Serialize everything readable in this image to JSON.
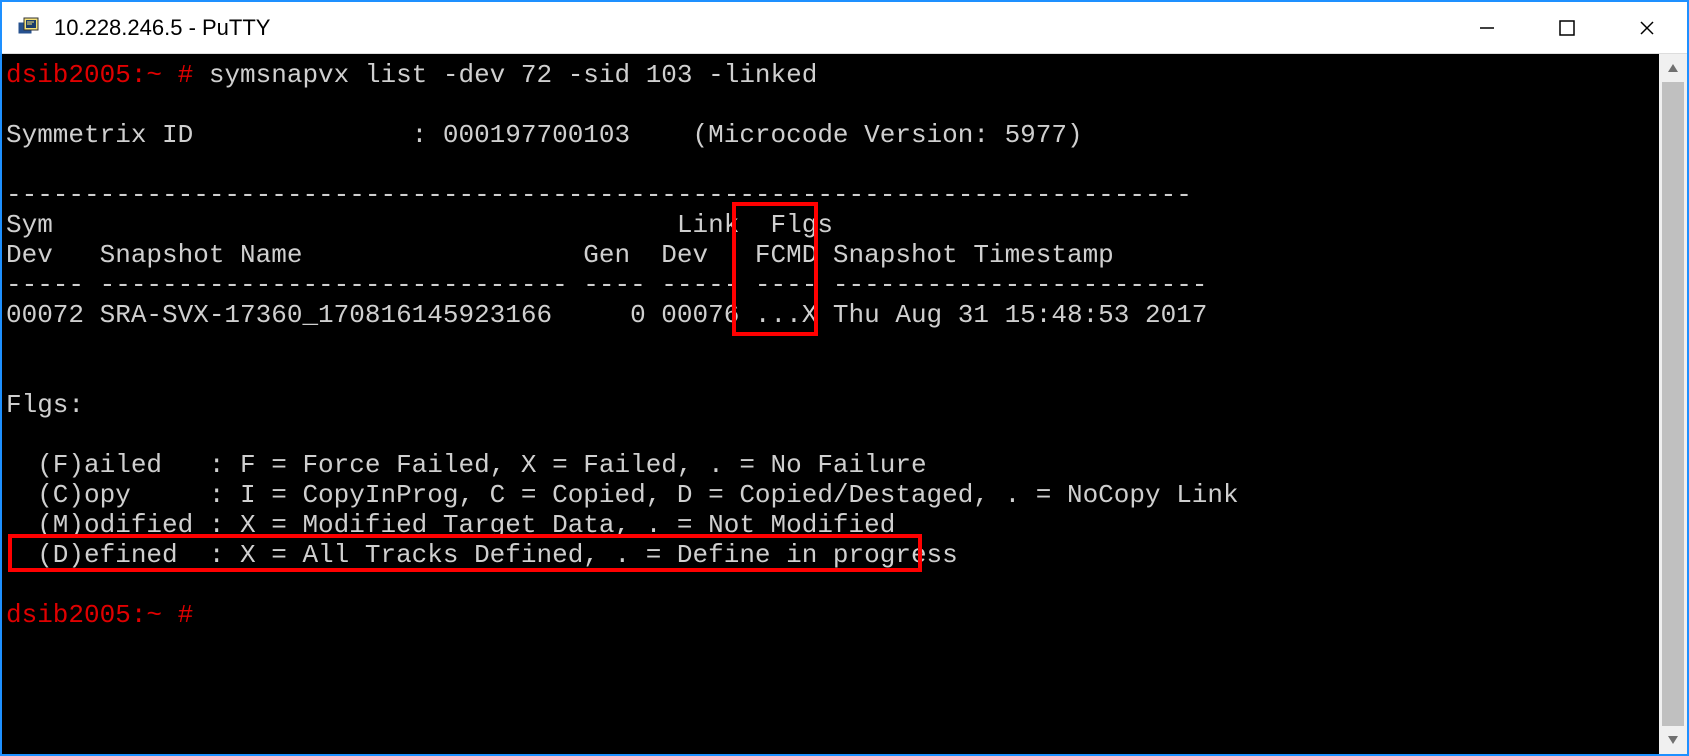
{
  "window": {
    "title": "10.228.246.5 - PuTTY"
  },
  "prompt1": {
    "prompt": "dsib2005:~ #",
    "command": " symsnapvx list -dev 72 -sid 103 -linked"
  },
  "sym_line": "Symmetrix ID              : 000197700103    (Microcode Version: 5977)",
  "dashes1": "----------------------------------------------------------------------------",
  "hdr1": "Sym                                        Link  Flgs",
  "hdr2": "Dev   Snapshot Name                  Gen  Dev   FCMD Snapshot Timestamp",
  "dashes2": "----- ------------------------------ ---- ----- ---- ------------------------",
  "row": "00072 SRA-SVX-17360_170816145923166     0 00076 ...X Thu Aug 31 15:48:53 2017",
  "flgs_label": "Flgs:",
  "legend_f": "  (F)ailed   : F = Force Failed, X = Failed, . = No Failure",
  "legend_c": "  (C)opy     : I = CopyInProg, C = Copied, D = Copied/Destaged, . = NoCopy Link",
  "legend_m": "  (M)odified : X = Modified Target Data, . = Not Modified",
  "legend_d": "  (D)efined  : X = All Tracks Defined, . = Define in progress",
  "prompt2": {
    "prompt": "dsib2005:~ #",
    "command": ""
  }
}
